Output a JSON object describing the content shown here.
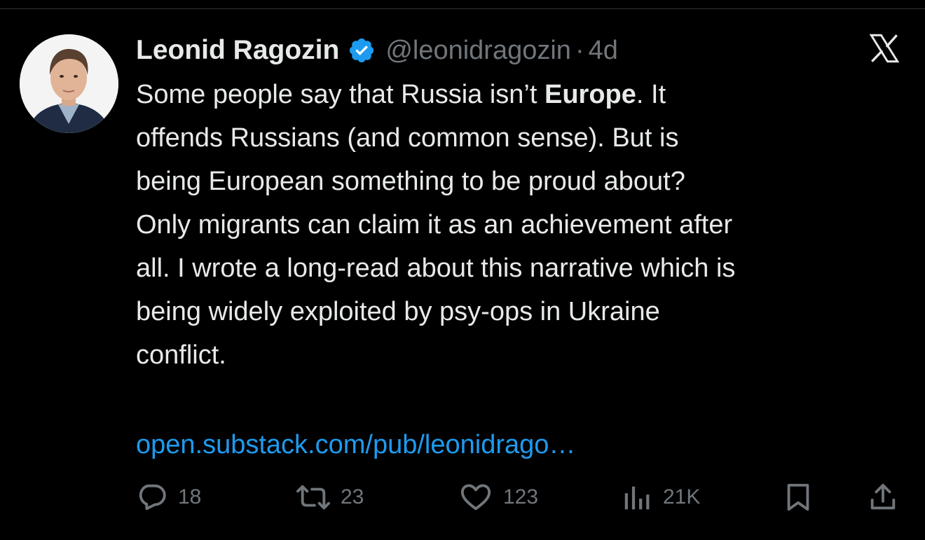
{
  "author": {
    "name": "Leonid Ragozin",
    "handle": "@leonidragozin",
    "separator": "·",
    "time": "4d",
    "verified": true,
    "avatar_icon": "author-photo"
  },
  "tweet": {
    "text_before": "Some people say that Russia isn’t ",
    "text_bold": "Europe",
    "text_after": ". It\noffends Russians (and common sense). But is\nbeing European something to be proud about?\nOnly migrants can claim it as an achievement after\nall. I wrote a long-read about this narrative which is\nbeing widely exploited by psy-ops in Ukraine\nconflict.",
    "link": "open.substack.com/pub/leonidrago…"
  },
  "actions": {
    "replies": "18",
    "reposts": "23",
    "likes": "123",
    "views": "21K"
  },
  "colors": {
    "background": "#000000",
    "text": "#e7e9ea",
    "muted": "#71767b",
    "link": "#1d9bf0",
    "verified": "#1d9bf0"
  },
  "icons": [
    "verified-badge-icon",
    "x-logo-icon",
    "reply-icon",
    "repost-icon",
    "like-icon",
    "views-icon",
    "bookmark-icon",
    "share-icon"
  ]
}
